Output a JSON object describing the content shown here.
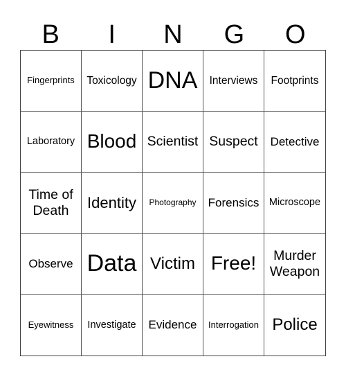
{
  "header": [
    "B",
    "I",
    "N",
    "G",
    "O"
  ],
  "cells": [
    {
      "text": "Fingerprints",
      "size": "s13"
    },
    {
      "text": "Toxicology",
      "size": "s15"
    },
    {
      "text": "DNA",
      "size": "s34"
    },
    {
      "text": "Interviews",
      "size": "s15"
    },
    {
      "text": "Footprints",
      "size": "s15"
    },
    {
      "text": "Laboratory",
      "size": "s14"
    },
    {
      "text": "Blood",
      "size": "s28"
    },
    {
      "text": "Scientist",
      "size": "s19"
    },
    {
      "text": "Suspect",
      "size": "s19"
    },
    {
      "text": "Detective",
      "size": "s17"
    },
    {
      "text": "Time of Death",
      "size": "s19"
    },
    {
      "text": "Identity",
      "size": "s22"
    },
    {
      "text": "Photography",
      "size": "s12"
    },
    {
      "text": "Forensics",
      "size": "s17"
    },
    {
      "text": "Microscope",
      "size": "s14"
    },
    {
      "text": "Observe",
      "size": "s17"
    },
    {
      "text": "Data",
      "size": "s34"
    },
    {
      "text": "Victim",
      "size": "s24"
    },
    {
      "text": "Free!",
      "size": "s28"
    },
    {
      "text": "Murder Weapon",
      "size": "s19"
    },
    {
      "text": "Eyewitness",
      "size": "s13"
    },
    {
      "text": "Investigate",
      "size": "s14"
    },
    {
      "text": "Evidence",
      "size": "s17"
    },
    {
      "text": "Interrogation",
      "size": "s13"
    },
    {
      "text": "Police",
      "size": "s24"
    }
  ]
}
